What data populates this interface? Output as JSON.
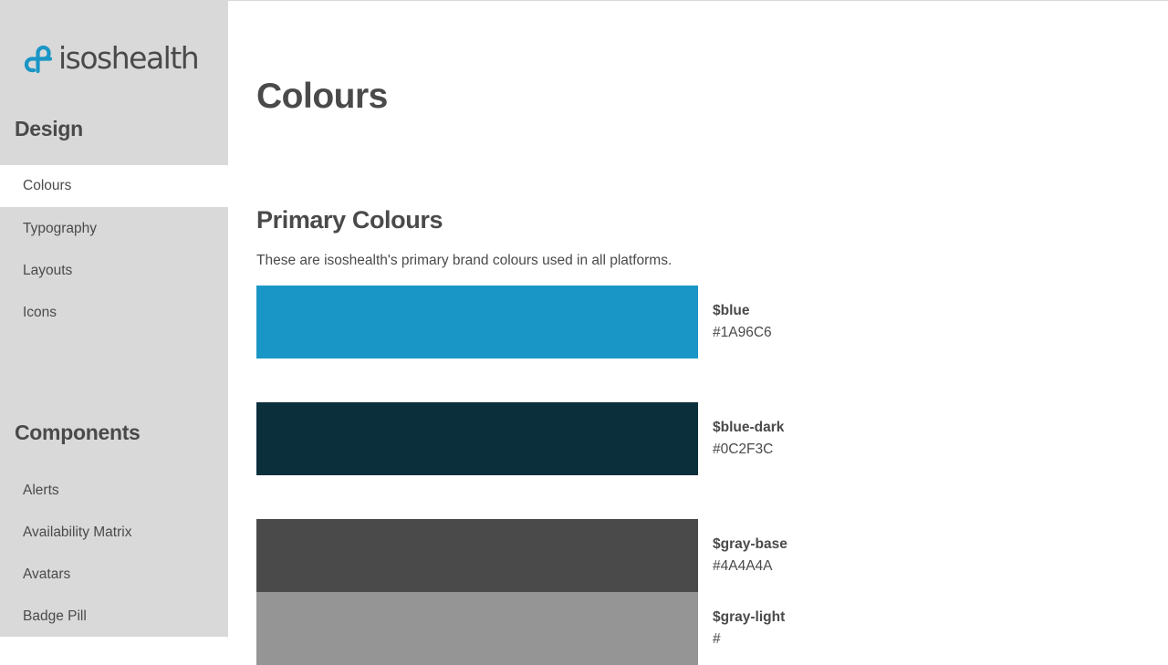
{
  "brand": {
    "name": "isoshealth",
    "logo_icon": "isoshealth-cross-logo-icon",
    "accent": "#1A96C6"
  },
  "sidebar": {
    "design_heading": "Design",
    "design_items": [
      {
        "label": "Colours",
        "active": true
      },
      {
        "label": "Typography",
        "active": false
      },
      {
        "label": "Layouts",
        "active": false
      },
      {
        "label": "Icons",
        "active": false
      }
    ],
    "components_heading": "Components",
    "component_items": [
      {
        "label": "Alerts"
      },
      {
        "label": "Availability Matrix"
      },
      {
        "label": "Avatars"
      },
      {
        "label": "Badge Pill"
      }
    ]
  },
  "main": {
    "title": "Colours",
    "section_title": "Primary Colours",
    "section_description": "These are isoshealth's primary brand colours used in all platforms.",
    "swatches": [
      {
        "name": "$blue",
        "hex": "#1A96C6",
        "color": "#1A96C6"
      },
      {
        "name": "$blue-dark",
        "hex": "#0C2F3C",
        "color": "#0C2F3C"
      },
      {
        "name": "$gray-base",
        "hex": "#4A4A4A",
        "color": "#4A4A4A"
      },
      {
        "name": "$gray-light",
        "hex": "#",
        "color": "#959595"
      }
    ]
  }
}
